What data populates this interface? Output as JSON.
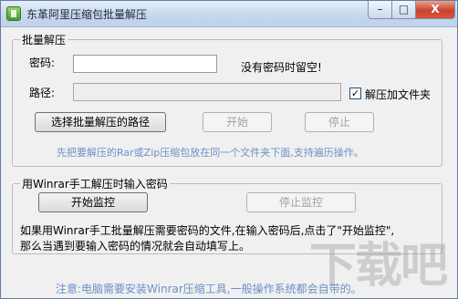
{
  "window": {
    "title": "东革阿里压缩包批量解压",
    "controls": {
      "minimize": "–",
      "maximize": "□",
      "close": "X"
    }
  },
  "batch_group": {
    "legend": "批量解压",
    "password_label": "密码:",
    "password_value": "",
    "no_password_hint": "没有密码时留空!",
    "path_label": "路径:",
    "path_value": "",
    "checkbox_label": "解压加文件夹",
    "checkbox_checked": true,
    "select_path_button": "选择批量解压的路径",
    "start_button": "开始",
    "stop_button": "停止",
    "hint": "先把要解压的Rar或Zip压缩包放在同一个文件夹下面,支持遍历操作。"
  },
  "monitor_group": {
    "legend": "用Winrar手工解压时输入密码",
    "start_monitor_button": "开始监控",
    "stop_monitor_button": "停止监控",
    "description_line1": "如果用Winrar手工批量解压需要密码的文件,在输入密码后,点击了\"开始监控\",",
    "description_line2": "那么当遇到要输入密码的情况就会自动填写上。"
  },
  "footer": {
    "note": "注意:电脑需要安装Winrar压缩工具,一般操作系统都会自带的。"
  },
  "watermark": {
    "text": "下载吧"
  }
}
